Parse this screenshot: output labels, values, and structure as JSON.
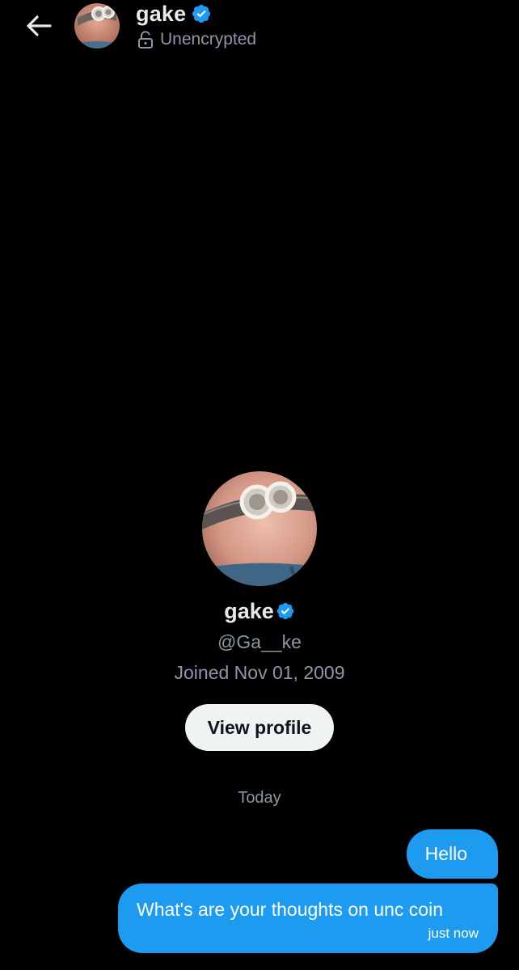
{
  "header": {
    "name": "gake",
    "encryption_status": "Unencrypted"
  },
  "profile": {
    "name": "gake",
    "handle": "@Ga__ke",
    "joined": "Joined Nov 01, 2009",
    "view_profile_label": "View profile"
  },
  "conversation": {
    "day_label": "Today",
    "messages": [
      {
        "text": "Hello"
      },
      {
        "text": "What's are your thoughts on unc coin",
        "time": "just now"
      }
    ]
  },
  "colors": {
    "background": "#000000",
    "accent": "#1d9bf0",
    "secondary_text": "#8b98a5"
  }
}
